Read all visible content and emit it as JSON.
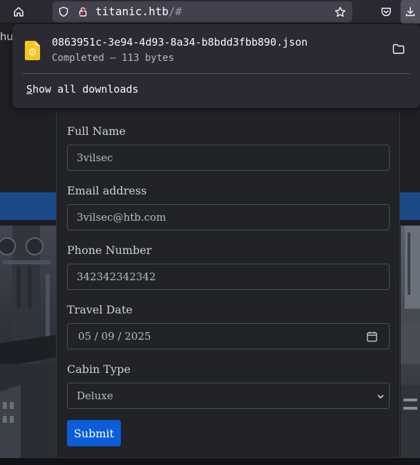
{
  "browser": {
    "url_host": "titanic.htb",
    "url_path": "/#"
  },
  "page": {
    "stub_text": "hu"
  },
  "downloads": {
    "filename": "0863951c-3e94-4d93-8a34-b8bdd3fbb890.json",
    "status": "Completed — 113 bytes",
    "show_all_accesskey": "S",
    "show_all_rest": "how all downloads"
  },
  "form": {
    "full_name_label": "Full Name",
    "full_name_value": "3vilsec",
    "email_label": "Email address",
    "email_value": "3vilsec@htb.com",
    "phone_label": "Phone Number",
    "phone_value": "342342342342",
    "travel_date_label": "Travel Date",
    "travel_date_value": "05 / 09 / 2025",
    "cabin_label": "Cabin Type",
    "cabin_value": "Deluxe",
    "submit_label": "Submit"
  },
  "colors": {
    "accent_blue": "#0b5ed7",
    "band_blue": "#1a4a8a",
    "file_icon_yellow": "#f3c623"
  }
}
